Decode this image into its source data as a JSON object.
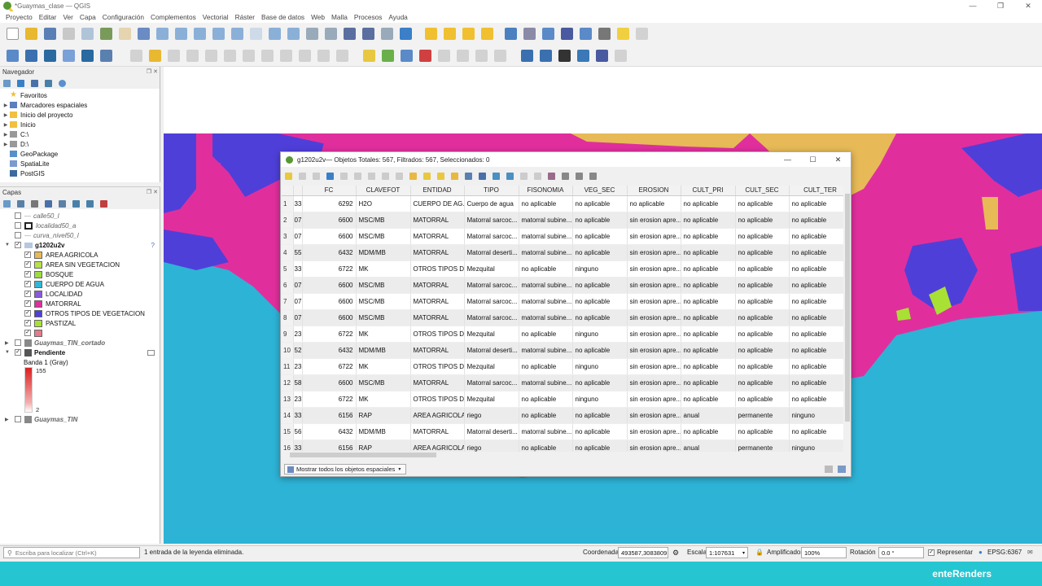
{
  "window": {
    "title": "*Guaymas_clase — QGIS"
  },
  "menu": [
    "Proyecto",
    "Editar",
    "Ver",
    "Capa",
    "Configuración",
    "Complementos",
    "Vectorial",
    "Ráster",
    "Base de datos",
    "Web",
    "Malla",
    "Procesos",
    "Ayuda"
  ],
  "navigator": {
    "title": "Navegador",
    "items": [
      {
        "label": "Favoritos",
        "icon": "star-icon"
      },
      {
        "label": "Marcadores espaciales",
        "icon": "bookmark-icon"
      },
      {
        "label": "Inicio del proyecto",
        "icon": "folder-icon"
      },
      {
        "label": "Inicio",
        "icon": "folder-icon"
      },
      {
        "label": "C:\\",
        "icon": "drive-icon"
      },
      {
        "label": "D:\\",
        "icon": "drive-icon"
      },
      {
        "label": "GeoPackage",
        "icon": "geopackage-icon"
      },
      {
        "label": "SpatiaLite",
        "icon": "spatialite-icon"
      },
      {
        "label": "PostGIS",
        "icon": "postgis-icon"
      }
    ]
  },
  "layers": {
    "title": "Capas",
    "items": [
      {
        "label": "calle50_l",
        "checked": false,
        "italic": true
      },
      {
        "label": "localidad50_a",
        "checked": false,
        "italic": true
      },
      {
        "label": "curva_nivel50_l",
        "checked": false,
        "italic": true
      },
      {
        "label": "g1202u2v",
        "checked": true,
        "bold": true
      }
    ],
    "classes": [
      {
        "label": "AREA AGRICOLA",
        "color": "#e7ba57"
      },
      {
        "label": "AREA SIN VEGETACION",
        "color": "#b8e04a"
      },
      {
        "label": "BOSQUE",
        "color": "#9edb42"
      },
      {
        "label": "CUERPO DE AGUA",
        "color": "#2fb7d8"
      },
      {
        "label": "LOCALIDAD",
        "color": "#8b5ad9"
      },
      {
        "label": "MATORRAL",
        "color": "#e02f9d"
      },
      {
        "label": "OTROS TIPOS DE VEGETACION",
        "color": "#4f3fd9"
      },
      {
        "label": "PASTIZAL",
        "color": "#a9e034"
      },
      {
        "label": "",
        "color": "#e37b8c"
      }
    ],
    "raster1": "Guaymas_TIN_cortado",
    "raster2": "Pendiente",
    "band": "Banda 1 (Gray)",
    "ramp_max": "155",
    "ramp_min": "2",
    "raster3": "Guaymas_TIN"
  },
  "attr_table": {
    "title": "g1202u2v— Objetos Totales: 567, Filtrados: 567, Seleccionados: 0",
    "columns": [
      "",
      "",
      "FC",
      "CLAVEFOT",
      "ENTIDAD",
      "TIPO",
      "FISONOMIA",
      "VEG_SEC",
      "EROSION",
      "CULT_PRI",
      "CULT_SEC",
      "CULT_TER"
    ],
    "rows": [
      [
        "1",
        "33",
        "6292",
        "H2O",
        "CUERPO DE AG...",
        "Cuerpo de agua",
        "no aplicable",
        "no aplicable",
        "no aplicable",
        "no aplicable",
        "no aplicable",
        "no aplicable"
      ],
      [
        "2",
        "07",
        "6600",
        "MSC/MB",
        "MATORRAL",
        "Matorral sarcoc...",
        "matorral subine...",
        "no aplicable",
        "sin erosion apre...",
        "no aplicable",
        "no aplicable",
        "no aplicable"
      ],
      [
        "3",
        "07",
        "6600",
        "MSC/MB",
        "MATORRAL",
        "Matorral sarcoc...",
        "matorral subine...",
        "no aplicable",
        "sin erosion apre...",
        "no aplicable",
        "no aplicable",
        "no aplicable"
      ],
      [
        "4",
        "55",
        "6432",
        "MDM/MB",
        "MATORRAL",
        "Matorral deserti...",
        "matorral subine...",
        "no aplicable",
        "sin erosion apre...",
        "no aplicable",
        "no aplicable",
        "no aplicable"
      ],
      [
        "5",
        "33",
        "6722",
        "MK",
        "OTROS TIPOS D...",
        "Mezquital",
        "no aplicable",
        "ninguno",
        "sin erosion apre...",
        "no aplicable",
        "no aplicable",
        "no aplicable"
      ],
      [
        "6",
        "07",
        "6600",
        "MSC/MB",
        "MATORRAL",
        "Matorral sarcoc...",
        "matorral subine...",
        "no aplicable",
        "sin erosion apre...",
        "no aplicable",
        "no aplicable",
        "no aplicable"
      ],
      [
        "7",
        "07",
        "6600",
        "MSC/MB",
        "MATORRAL",
        "Matorral sarcoc...",
        "matorral subine...",
        "no aplicable",
        "sin erosion apre...",
        "no aplicable",
        "no aplicable",
        "no aplicable"
      ],
      [
        "8",
        "07",
        "6600",
        "MSC/MB",
        "MATORRAL",
        "Matorral sarcoc...",
        "matorral subine...",
        "no aplicable",
        "sin erosion apre...",
        "no aplicable",
        "no aplicable",
        "no aplicable"
      ],
      [
        "9",
        "23",
        "6722",
        "MK",
        "OTROS TIPOS D...",
        "Mezquital",
        "no aplicable",
        "ninguno",
        "sin erosion apre...",
        "no aplicable",
        "no aplicable",
        "no aplicable"
      ],
      [
        "10",
        "52",
        "6432",
        "MDM/MB",
        "MATORRAL",
        "Matorral deserti...",
        "matorral subine...",
        "no aplicable",
        "sin erosion apre...",
        "no aplicable",
        "no aplicable",
        "no aplicable"
      ],
      [
        "11",
        "23",
        "6722",
        "MK",
        "OTROS TIPOS D...",
        "Mezquital",
        "no aplicable",
        "ninguno",
        "sin erosion apre...",
        "no aplicable",
        "no aplicable",
        "no aplicable"
      ],
      [
        "12",
        "58",
        "6600",
        "MSC/MB",
        "MATORRAL",
        "Matorral sarcoc...",
        "matorral subine...",
        "no aplicable",
        "sin erosion apre...",
        "no aplicable",
        "no aplicable",
        "no aplicable"
      ],
      [
        "13",
        "23",
        "6722",
        "MK",
        "OTROS TIPOS D...",
        "Mezquital",
        "no aplicable",
        "ninguno",
        "sin erosion apre...",
        "no aplicable",
        "no aplicable",
        "no aplicable"
      ],
      [
        "14",
        "33",
        "6156",
        "RAP",
        "AREA AGRICOLA",
        "riego",
        "no aplicable",
        "no aplicable",
        "sin erosion apre...",
        "anual",
        "permanente",
        "ninguno"
      ],
      [
        "15",
        "56",
        "6432",
        "MDM/MB",
        "MATORRAL",
        "Matorral deserti...",
        "matorral subine...",
        "no aplicable",
        "sin erosion apre...",
        "no aplicable",
        "no aplicable",
        "no aplicable"
      ],
      [
        "16",
        "33",
        "6156",
        "RAP",
        "AREA AGRICOLA",
        "riego",
        "no aplicable",
        "no aplicable",
        "sin erosion apre...",
        "anual",
        "permanente",
        "ninguno"
      ]
    ],
    "filter_button": "Mostrar todos los objetos espaciales"
  },
  "status": {
    "search_placeholder": "Escriba para localizar (Ctrl+K)",
    "message": "1 entrada de la leyenda eliminada.",
    "coord_label": "Coordenada",
    "coord_value": "493587,3083809",
    "scale_label": "Escala",
    "scale_value": "1:107631",
    "magnifier_label": "Amplificador",
    "magnifier_value": "100%",
    "rotation_label": "Rotación",
    "rotation_value": "0.0 °",
    "render_label": "Representar",
    "crs": "EPSG:6367"
  },
  "brand": "enteRenders"
}
